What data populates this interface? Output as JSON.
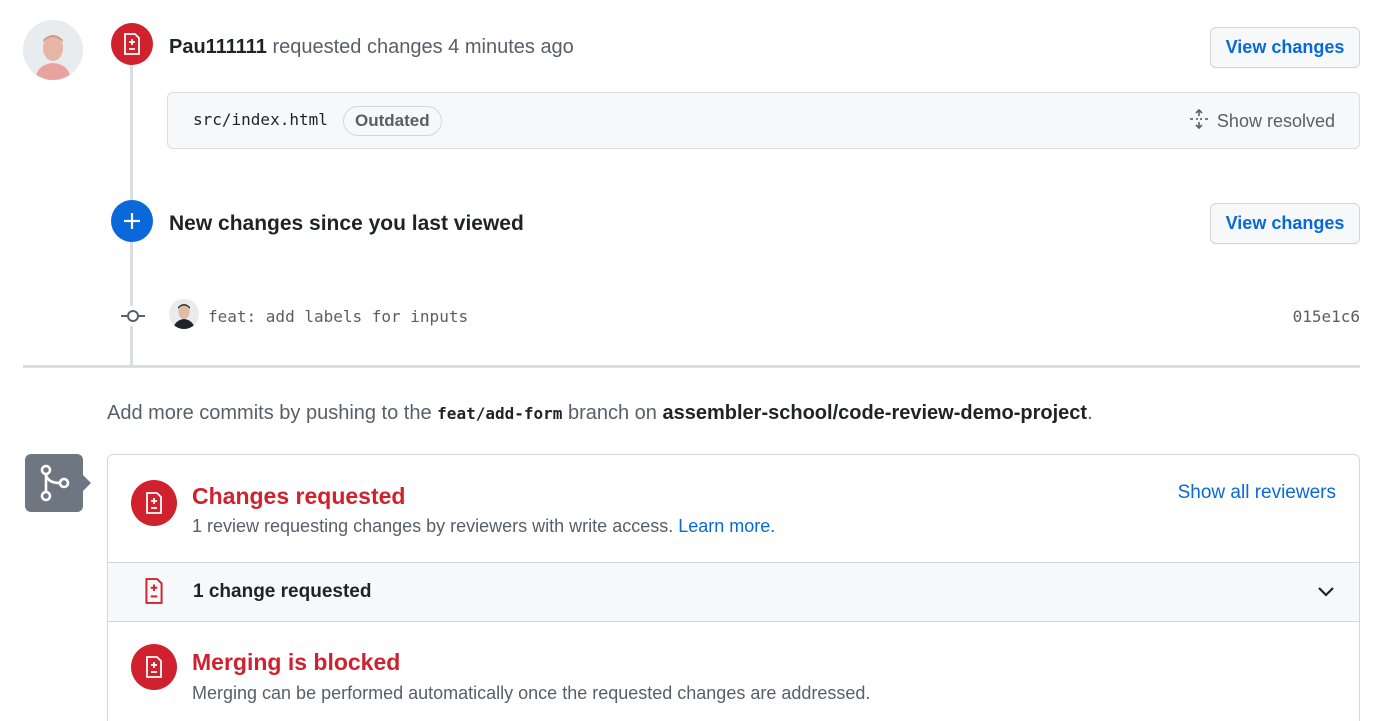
{
  "review": {
    "author": "Pau111111",
    "action": "requested changes",
    "time": "4 minutes ago",
    "view_changes_label": "View changes",
    "file_path": "src/index.html",
    "outdated_label": "Outdated",
    "show_resolved_label": "Show resolved",
    "icons": {
      "badge": "file-diff-icon",
      "show_resolved": "unfold-icon"
    }
  },
  "new_changes": {
    "text": "New changes since you last viewed",
    "view_changes_label": "View changes",
    "icon": "plus-icon"
  },
  "commit": {
    "message": "feat: add labels for inputs",
    "sha": "015e1c6",
    "icon": "git-commit-icon"
  },
  "add_more": {
    "prefix": "Add more commits by pushing to the",
    "branch": "feat/add-form",
    "middle": "branch on",
    "repo": "assembler-school/code-review-demo-project",
    "suffix": "."
  },
  "merge_box": {
    "icon": "git-merge-icon",
    "changes_requested": {
      "title": "Changes requested",
      "subtitle": "1 review requesting changes by reviewers with write access.",
      "learn_more": "Learn more.",
      "show_all_reviewers": "Show all reviewers"
    },
    "change_row": {
      "label": "1 change requested"
    },
    "blocked": {
      "title": "Merging is blocked",
      "subtitle": "Merging can be performed automatically once the requested changes are addressed."
    }
  },
  "colors": {
    "danger": "#cf222e",
    "accent": "#0969da",
    "muted": "#57606a",
    "border": "#d0d7de"
  }
}
